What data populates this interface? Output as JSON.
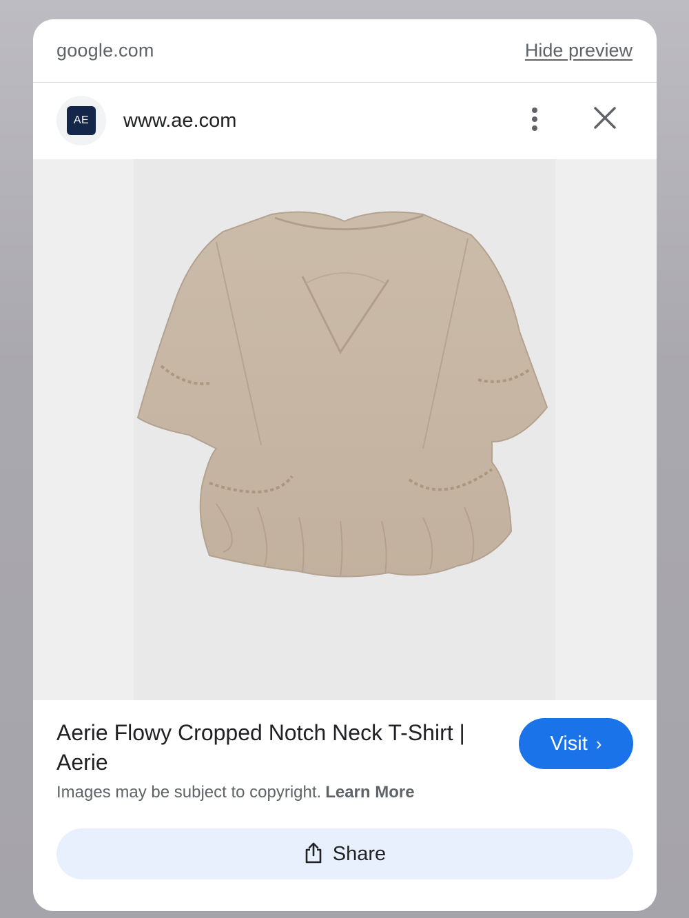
{
  "header": {
    "domain": "google.com",
    "hide_preview": "Hide preview"
  },
  "site": {
    "favicon_text": "AE",
    "url": "www.ae.com",
    "more_icon": "more-vert-icon",
    "close_icon": "close-icon"
  },
  "image": {
    "alt": "Aerie Flowy Cropped Notch Neck T-Shirt product photo"
  },
  "product": {
    "title": "Aerie Flowy Cropped Notch Neck T-Shirt | Aerie",
    "visit_label": "Visit",
    "copyright_text": "Images may be subject to copyright.",
    "learn_more": "Learn More",
    "share_label": "Share"
  },
  "colors": {
    "accent": "#1a73e8",
    "share_bg": "#e8f0fe",
    "favicon_bg": "#14264a"
  }
}
